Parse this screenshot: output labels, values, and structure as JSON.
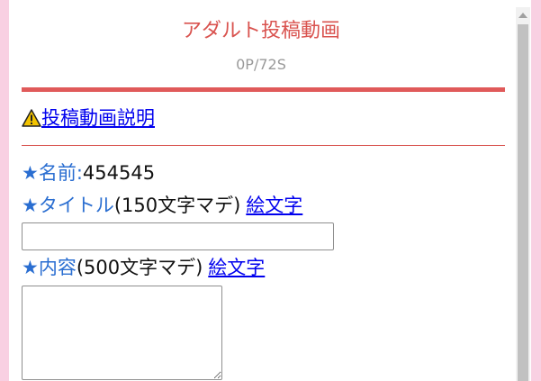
{
  "header": {
    "title": "アダルト投稿動画",
    "stats": "0P/72S"
  },
  "notice": {
    "icon": "warning-icon",
    "link_label": "投稿動画説明"
  },
  "form": {
    "name_label": "★名前:",
    "name_value": "454545",
    "title_label": "★タイトル",
    "title_limit": "(150文字マデ)",
    "title_emoji_link": "絵文字",
    "title_value": "",
    "body_label": "★内容",
    "body_limit": "(500文字マデ)",
    "body_emoji_link": "絵文字",
    "body_value": ""
  },
  "colors": {
    "background": "#f9d0e2",
    "accent_red": "#d9534f",
    "label_blue": "#2a6ed1",
    "link_blue": "#0000ee"
  }
}
